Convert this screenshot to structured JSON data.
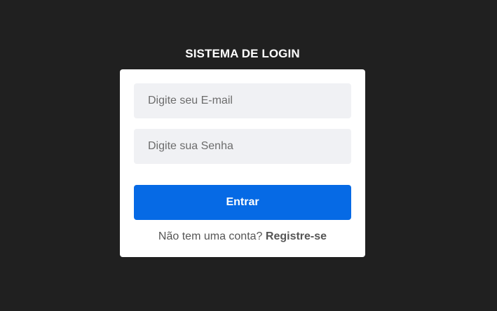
{
  "header": {
    "title": "SISTEMA DE LOGIN"
  },
  "form": {
    "email_placeholder": "Digite seu E-mail",
    "password_placeholder": "Digite sua Senha",
    "submit_label": "Entrar",
    "signup_prompt": "Não tem uma conta?",
    "signup_link": "Registre-se"
  },
  "colors": {
    "background": "#202020",
    "card": "#ffffff",
    "input_background": "#f0f1f4",
    "primary_button": "#066ae5",
    "button_text": "#ffffff",
    "muted_text": "#555555"
  }
}
